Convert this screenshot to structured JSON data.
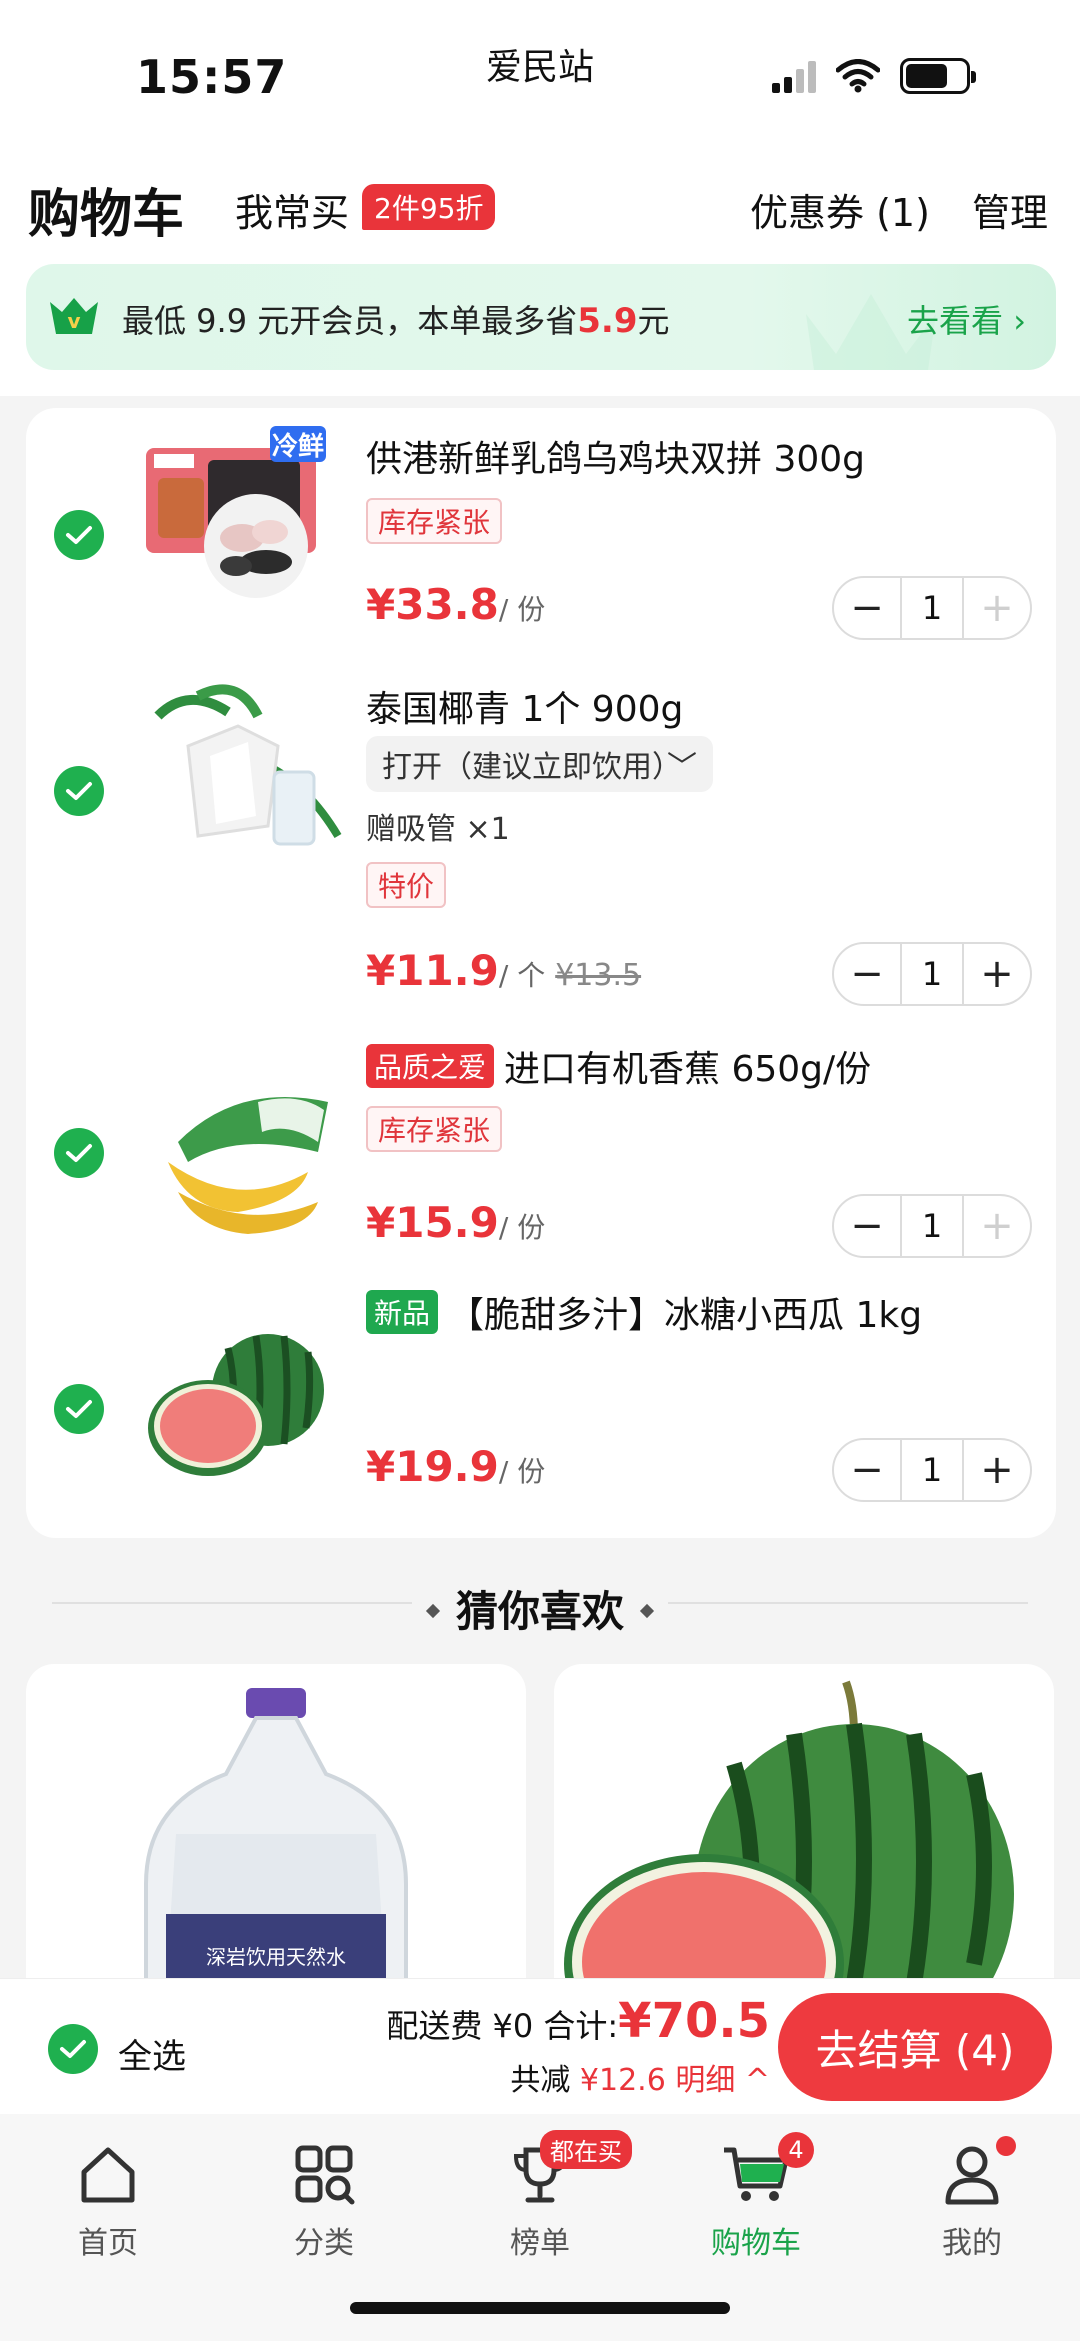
{
  "status_bar": {
    "time": "15:57",
    "center_text": "爱民站"
  },
  "header": {
    "title": "购物车",
    "often_buy": "我常买",
    "often_badge": "2件95折",
    "coupon": "优惠券 (1)",
    "manage": "管理"
  },
  "member_banner": {
    "text_before": "最低 9.9 元开会员，本单最多省",
    "highlight": "5.9",
    "text_after": "元",
    "action": "去看看 ›"
  },
  "cart_items": [
    {
      "title": "供港新鲜乳鸽乌鸡块双拼 300g",
      "image_badge": "冷鲜",
      "tag": "库存紧张",
      "price": "¥33.8",
      "unit": "/ 份",
      "quantity": "1",
      "minus": "−",
      "plus": "+"
    },
    {
      "title": "泰国椰青 1个 900g",
      "option": "打开（建议立即饮用）﹀",
      "gift": "赠吸管 ×1",
      "tag": "特价",
      "price": "¥11.9",
      "unit": "/ 个",
      "old_price": "¥13.5",
      "quantity": "1",
      "minus": "−",
      "plus": "+"
    },
    {
      "label": "品质之爱",
      "title": "进口有机香蕉 650g/份",
      "tag": "库存紧张",
      "price": "¥15.9",
      "unit": "/ 份",
      "quantity": "1",
      "minus": "−",
      "plus": "+"
    },
    {
      "label": "新品",
      "title": "【脆甜多汁】冰糖小西瓜 1kg",
      "price": "¥19.9",
      "unit": "/ 份",
      "quantity": "1",
      "minus": "−",
      "plus": "+"
    }
  ],
  "recommend": {
    "title": "猜你喜欢",
    "water_label": "深岩饮用天然水"
  },
  "checkout": {
    "select_all": "全选",
    "delivery": "配送费 ¥0 合计:",
    "total": "¥70.5",
    "discount_label": "共减",
    "discount": "¥12.6 明细 ^",
    "pay_button": "去结算 (4)"
  },
  "tabbar": {
    "items": [
      {
        "label": "首页"
      },
      {
        "label": "分类"
      },
      {
        "label": "榜单",
        "badge": "都在买"
      },
      {
        "label": "购物车",
        "badge": "4"
      },
      {
        "label": "我的"
      }
    ]
  },
  "colors": {
    "accent_red": "#e9343a",
    "accent_green": "#1aa34a",
    "check_green": "#1fb04f"
  }
}
